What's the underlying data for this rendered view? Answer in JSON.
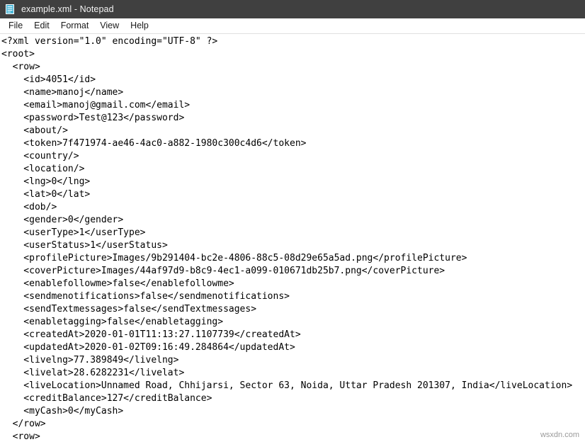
{
  "window": {
    "title": "example.xml - Notepad",
    "icon": "notepad-icon",
    "title_bar_color": "#404040",
    "title_text_color": "#f2f2f2",
    "icon_color": "#4db8d8"
  },
  "menu": {
    "items": [
      {
        "label": "File"
      },
      {
        "label": "Edit"
      },
      {
        "label": "Format"
      },
      {
        "label": "View"
      },
      {
        "label": "Help"
      }
    ]
  },
  "editor": {
    "background_color": "#ffffff",
    "text_color": "#000000",
    "lines": [
      "<?xml version=\"1.0\" encoding=\"UTF-8\" ?>",
      "<root>",
      "  <row>",
      "    <id>4051</id>",
      "    <name>manoj</name>",
      "    <email>manoj@gmail.com</email>",
      "    <password>Test@123</password>",
      "    <about/>",
      "    <token>7f471974-ae46-4ac0-a882-1980c300c4d6</token>",
      "    <country/>",
      "    <location/>",
      "    <lng>0</lng>",
      "    <lat>0</lat>",
      "    <dob/>",
      "    <gender>0</gender>",
      "    <userType>1</userType>",
      "    <userStatus>1</userStatus>",
      "    <profilePicture>Images/9b291404-bc2e-4806-88c5-08d29e65a5ad.png</profilePicture>",
      "    <coverPicture>Images/44af97d9-b8c9-4ec1-a099-010671db25b7.png</coverPicture>",
      "    <enablefollowme>false</enablefollowme>",
      "    <sendmenotifications>false</sendmenotifications>",
      "    <sendTextmessages>false</sendTextmessages>",
      "    <enabletagging>false</enabletagging>",
      "    <createdAt>2020-01-01T11:13:27.1107739</createdAt>",
      "    <updatedAt>2020-01-02T09:16:49.284864</updatedAt>",
      "    <livelng>77.389849</livelng>",
      "    <livelat>28.6282231</livelat>",
      "    <liveLocation>Unnamed Road, Chhijarsi, Sector 63, Noida, Uttar Pradesh 201307, India</liveLocation>",
      "    <creditBalance>127</creditBalance>",
      "    <myCash>0</myCash>",
      "  </row>",
      "  <row>"
    ]
  },
  "watermark": {
    "text": "wsxdn.com"
  }
}
